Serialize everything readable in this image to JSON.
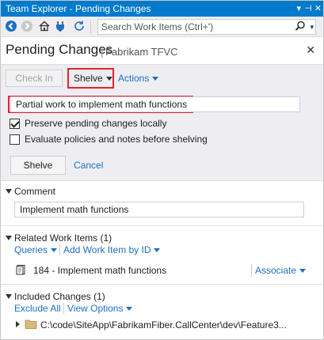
{
  "window": {
    "title": "Team Explorer - Pending Changes"
  },
  "toolbar": {
    "search_placeholder": "Search Work Items (Ctrl+')"
  },
  "header": {
    "title": "Pending Changes",
    "subtitle": "Fabrikam TFVC"
  },
  "actions": {
    "check_in": "Check In",
    "shelve": "Shelve",
    "actions": "Actions"
  },
  "shelve_panel": {
    "shelveset_name": "Partial work to implement math functions",
    "preserve_label": "Preserve pending changes locally",
    "preserve_checked": true,
    "evaluate_label": "Evaluate policies and notes before shelving",
    "evaluate_checked": false,
    "shelve_button": "Shelve",
    "cancel_link": "Cancel"
  },
  "comment": {
    "heading": "Comment",
    "value": "Implement math functions"
  },
  "related": {
    "heading": "Related Work Items (1)",
    "queries": "Queries",
    "add_by_id": "Add Work Item by ID",
    "item": "184 - Implement math functions",
    "associate": "Associate"
  },
  "included": {
    "heading": "Included Changes (1)",
    "exclude_all": "Exclude All",
    "view_options": "View Options",
    "path": "C:\\code\\SiteApp\\FabrikamFiber.CallCenter\\dev\\Feature3..."
  }
}
